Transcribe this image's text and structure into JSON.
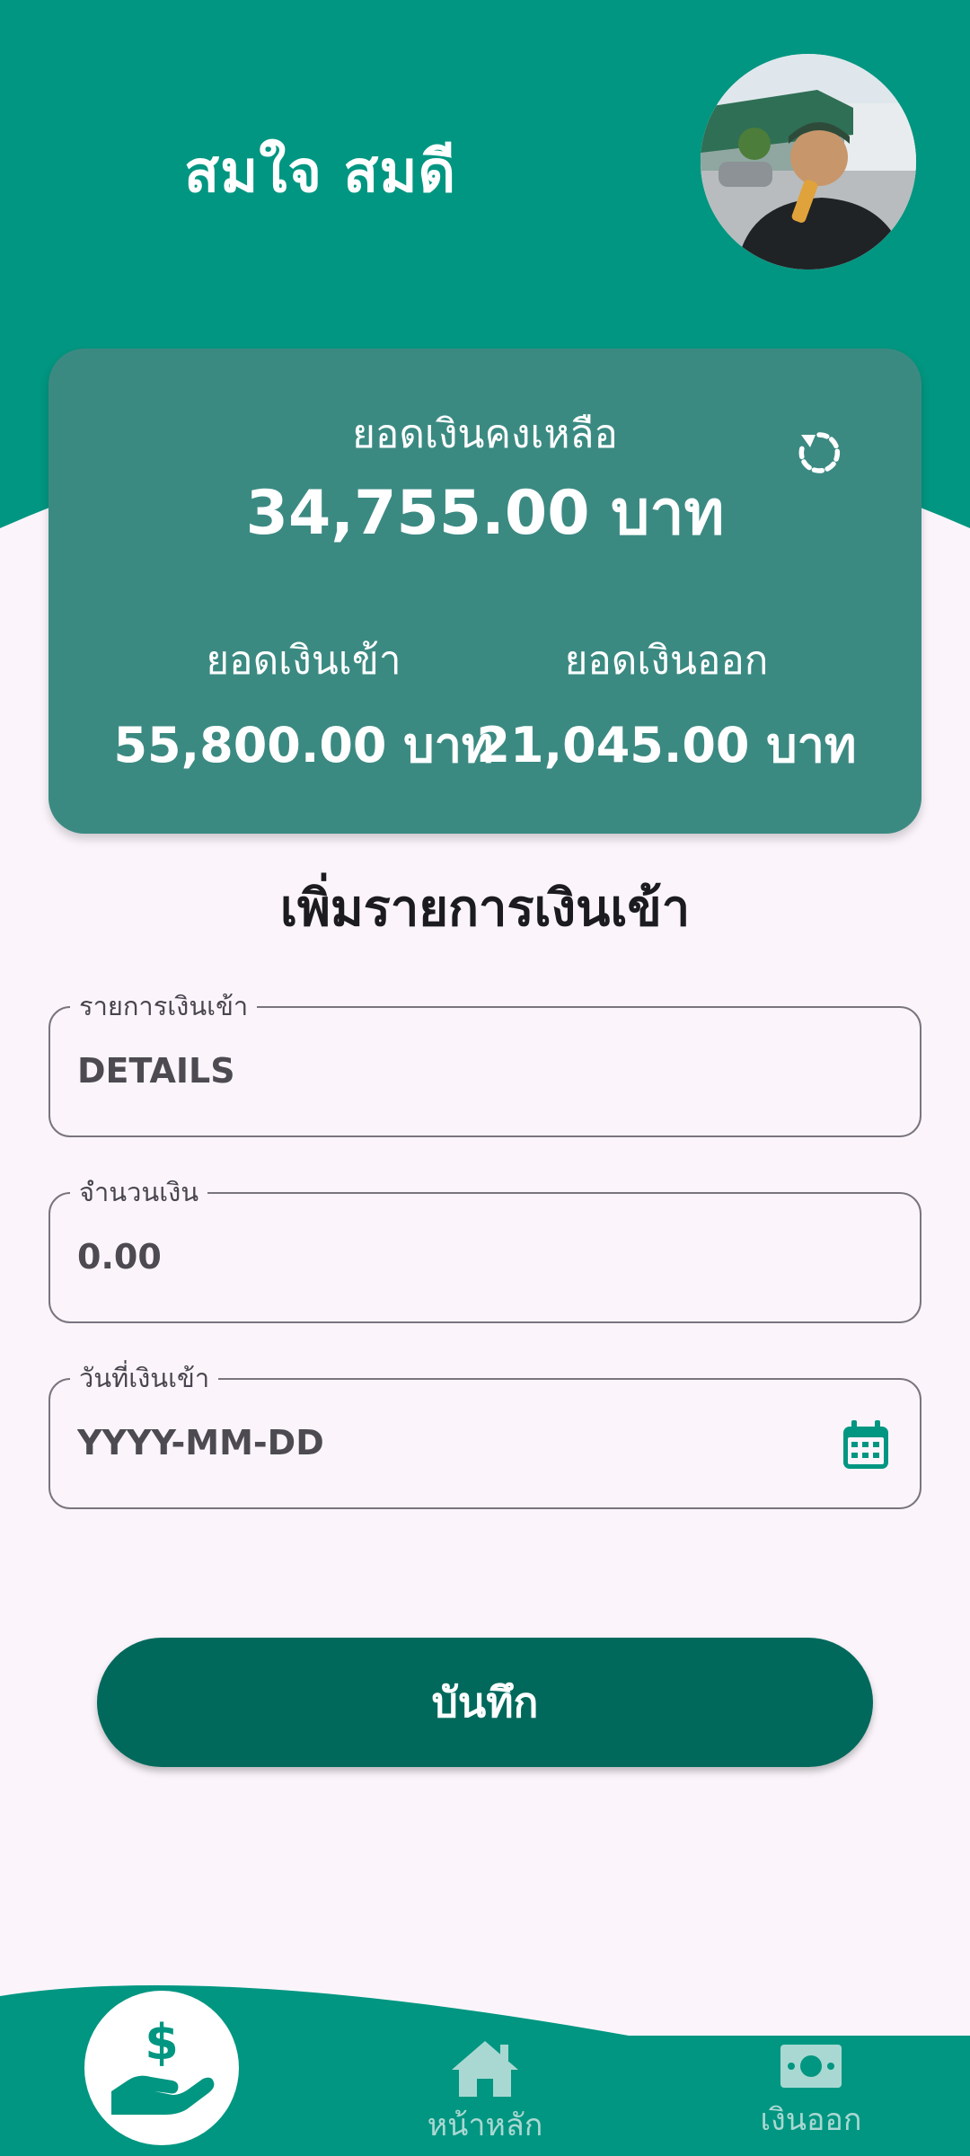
{
  "user": {
    "name": "สมใจ สมดี"
  },
  "balance": {
    "label": "ยอดเงินคงเหลือ",
    "value": "34,755.00 บาท",
    "income_label": "ยอดเงินเข้า",
    "income_value": "55,800.00 บาท",
    "expense_label": "ยอดเงินออก",
    "expense_value": "21,045.00 บาท"
  },
  "form": {
    "title": "เพิ่มรายการเงินเข้า",
    "fields": [
      {
        "label": "รายการเงินเข้า",
        "placeholder": "DETAILS",
        "value": ""
      },
      {
        "label": "จำนวนเงิน",
        "placeholder": "0.00",
        "value": ""
      },
      {
        "label": "วันที่เงินเข้า",
        "placeholder": "YYYY-MM-DD",
        "value": ""
      }
    ],
    "save_label": "บันทึก"
  },
  "nav": {
    "active_icon": "hand-dollar-icon",
    "items": [
      {
        "label": "หน้าหลัก",
        "icon": "home-icon"
      },
      {
        "label": "เงินออก",
        "icon": "money-bill-icon"
      }
    ]
  },
  "colors": {
    "primary": "#009681",
    "card": "#3b8a82",
    "button": "#00695c",
    "background": "#fbf5fb",
    "nav_label": "#a9d8d2"
  }
}
